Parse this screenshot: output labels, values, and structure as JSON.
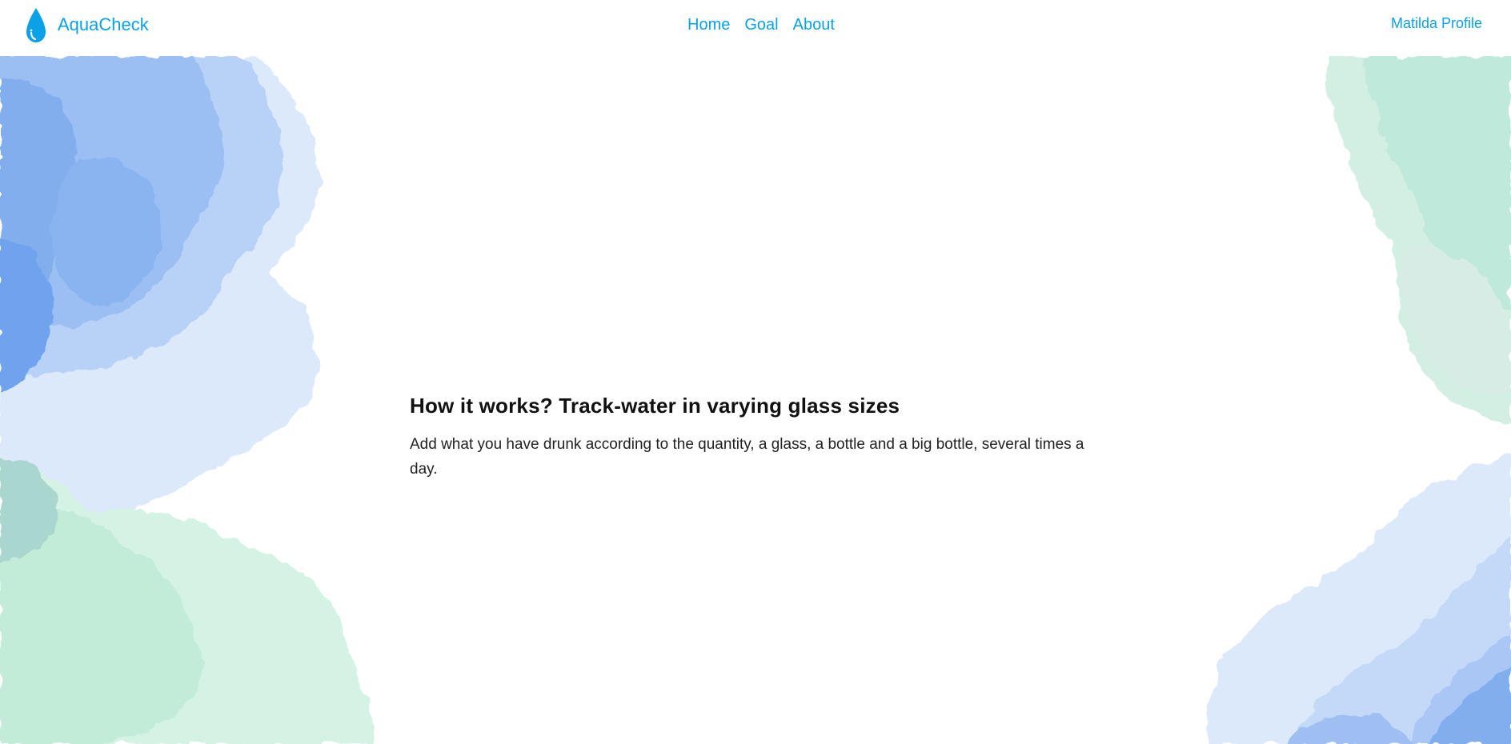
{
  "app": {
    "name": "AquaCheck",
    "logo_icon": "water-drop-icon",
    "accent_color": "#0aa1e6"
  },
  "nav": {
    "items": [
      {
        "label": "Home"
      },
      {
        "label": "Goal"
      },
      {
        "label": "About"
      }
    ],
    "profile_label": "Matilda Profile"
  },
  "main": {
    "heading": "How it works? Track-water in varying glass sizes",
    "description": "Add what you have drunk according to the quantity, a glass, a bottle and a big bottle, several times a day."
  },
  "decoration": {
    "blue_color": "#6fa3ee",
    "green_color": "#a8e6cc"
  }
}
